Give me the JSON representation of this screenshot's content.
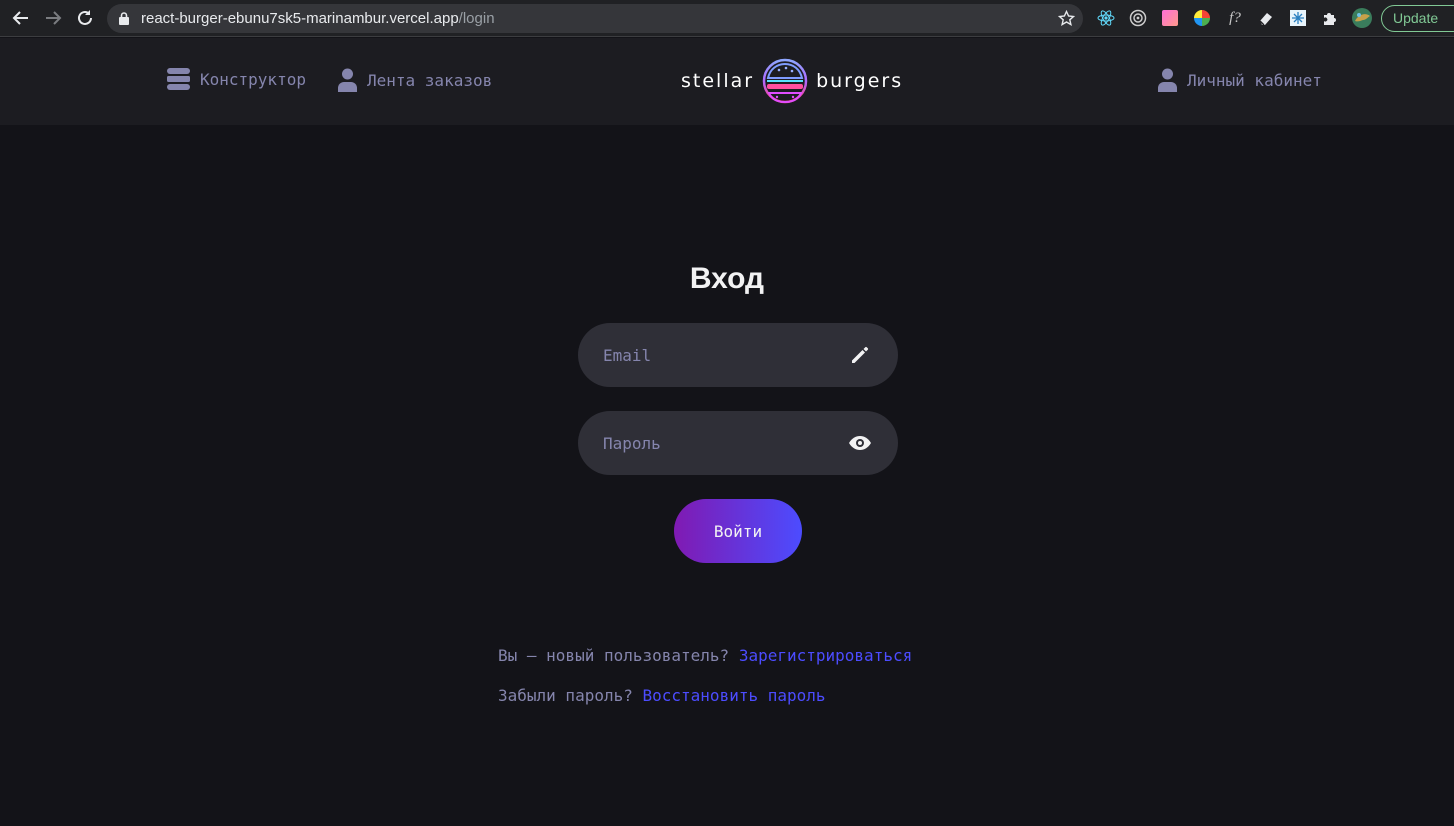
{
  "browser": {
    "url_host": "react-burger-ebunu7sk5-marinambur.vercel.app",
    "url_path": "/login",
    "update_label": "Update",
    "extensions": [
      "react-devtools-icon",
      "target-icon",
      "gradient-square-icon",
      "color-wheel-icon",
      "font-question-icon",
      "eraser-icon",
      "snowflake-icon",
      "puzzle-icon",
      "avatar-icon"
    ]
  },
  "header": {
    "nav": {
      "constructor_label": "Конструктор",
      "feed_label": "Лента заказов",
      "profile_label": "Личный кабинет"
    },
    "logo": {
      "left_word": "stellar",
      "right_word": "burgers"
    }
  },
  "login": {
    "title": "Вход",
    "email": {
      "placeholder": "Email",
      "value": ""
    },
    "password": {
      "placeholder": "Пароль",
      "value": ""
    },
    "submit_label": "Войти",
    "register": {
      "prompt": "Вы — новый пользователь?",
      "link": "Зарегистрироваться"
    },
    "forgot": {
      "prompt": "Забыли пароль?",
      "link": "Восстановить пароль"
    }
  },
  "colors": {
    "background": "#131318",
    "header": "#1c1c21",
    "input": "#2f2f37",
    "inactive": "#8585ad",
    "accent": "#4c4cff",
    "gradient_start": "#801ab2",
    "gradient_end": "#4c4cff"
  }
}
